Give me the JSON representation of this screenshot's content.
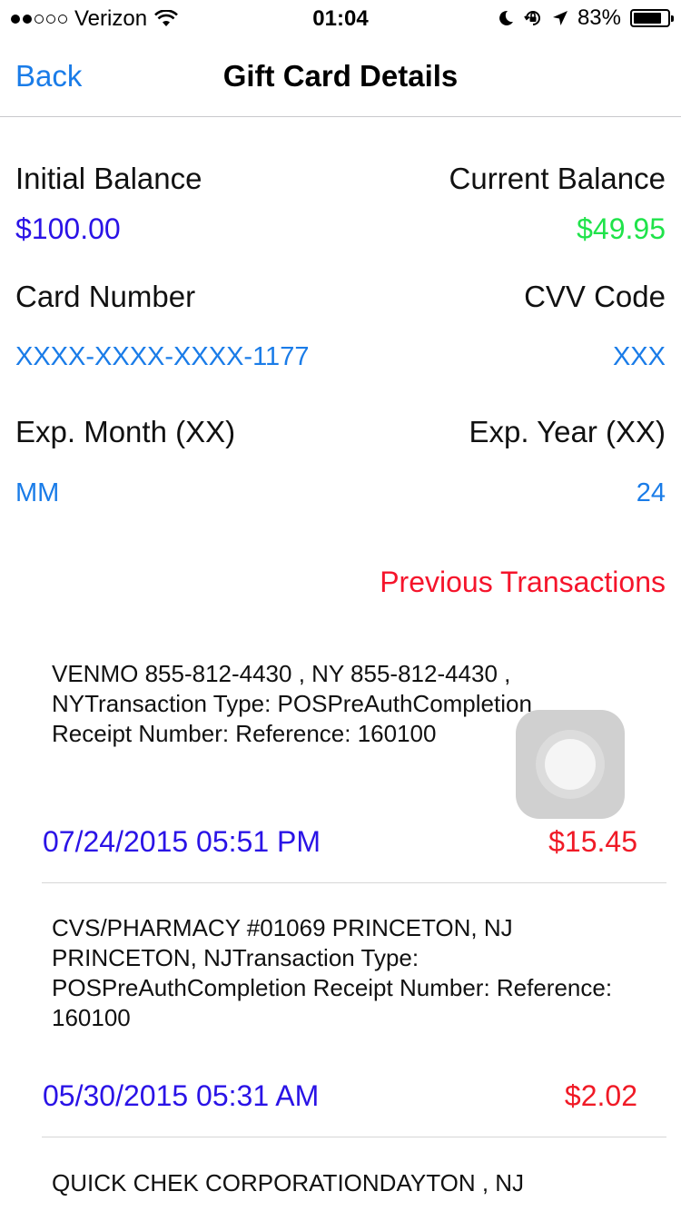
{
  "status_bar": {
    "carrier": "Verizon",
    "time": "01:04",
    "battery_percent": "83%",
    "battery_level": 0.83,
    "signal_bars": 2,
    "icons": [
      "wifi-icon",
      "moon-icon",
      "rotation-lock-icon",
      "location-arrow-icon",
      "battery-icon"
    ]
  },
  "nav": {
    "back_label": "Back",
    "title": "Gift Card Details"
  },
  "card": {
    "initial_balance_label": "Initial Balance",
    "initial_balance": "$100.00",
    "current_balance_label": "Current Balance",
    "current_balance": "$49.95",
    "card_number_label": "Card Number",
    "card_number": "XXXX-XXXX-XXXX-1177",
    "cvv_label": "CVV Code",
    "cvv": "XXX",
    "exp_month_label": "Exp. Month (XX)",
    "exp_month": "MM",
    "exp_year_label": "Exp. Year (XX)",
    "exp_year": "24"
  },
  "transactions": {
    "heading": "Previous Transactions",
    "items": [
      {
        "description": "VENMO 855-812-4430 , NY 855-812-4430 , NYTransaction Type: POSPreAuthCompletion Receipt Number: Reference: 160100",
        "date": "07/24/2015 05:51 PM",
        "amount": "$15.45"
      },
      {
        "description": "CVS/PHARMACY #01069 PRINCETON, NJ PRINCETON, NJTransaction Type: POSPreAuthCompletion Receipt Number: Reference: 160100",
        "date": "05/30/2015 05:31 AM",
        "amount": "$2.02"
      },
      {
        "description": "QUICK CHEK CORPORATIONDAYTON , NJ"
      }
    ]
  },
  "colors": {
    "link_blue": "#1a7ce8",
    "value_blue": "#2a13e6",
    "balance_green": "#1fe34a",
    "alert_red": "#f5142b"
  }
}
